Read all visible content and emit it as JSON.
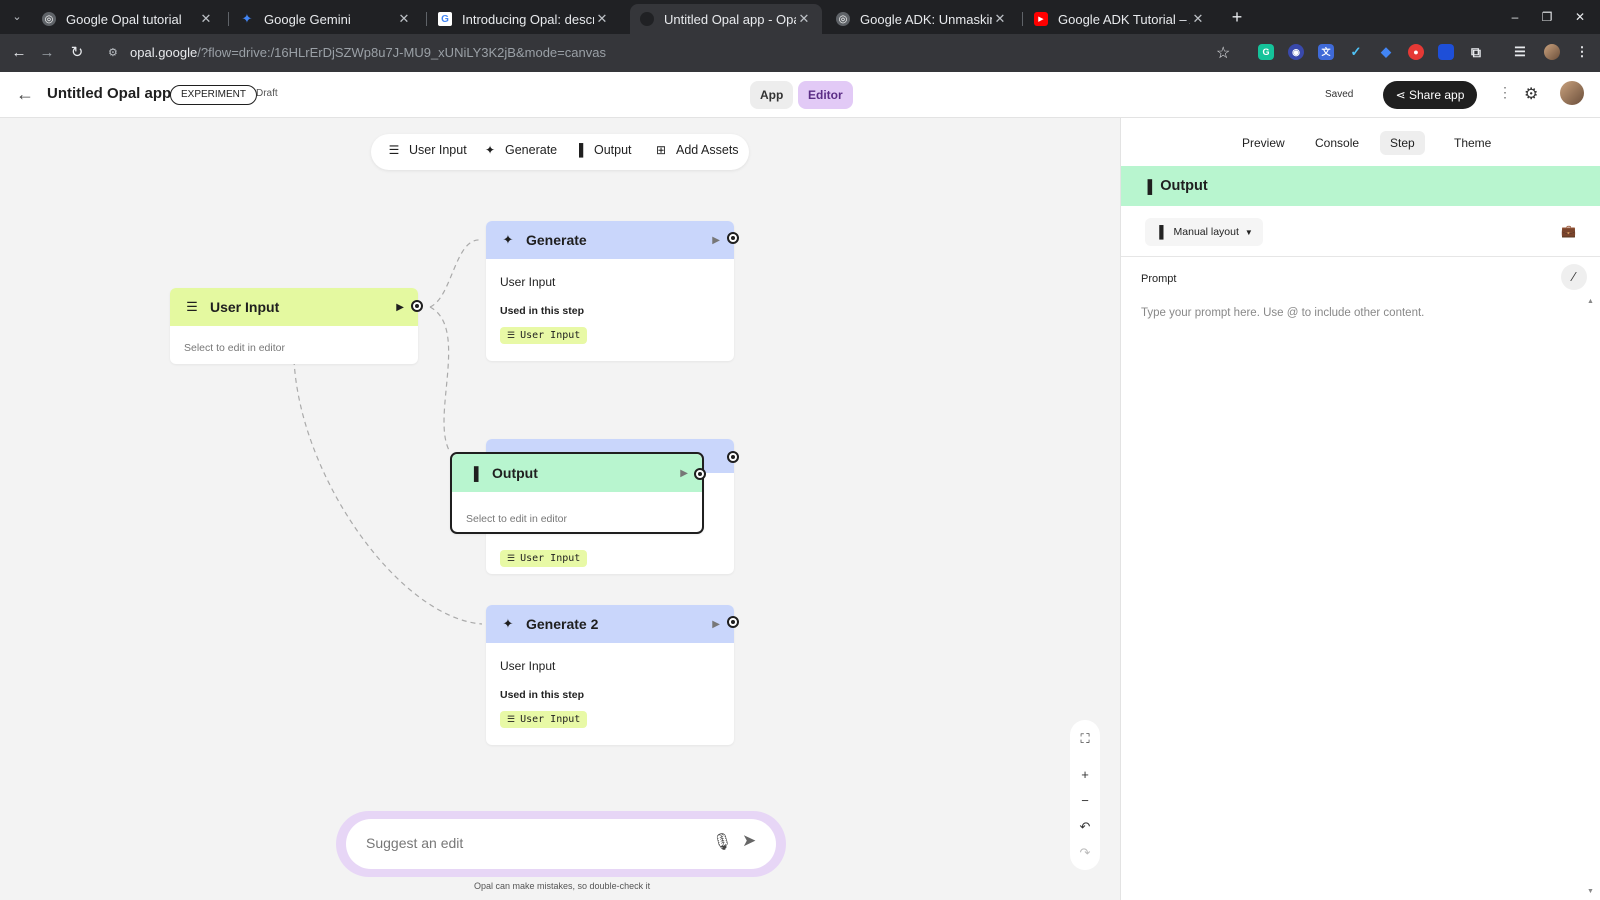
{
  "browser": {
    "tabs": [
      {
        "label": "Google Opal tutorial",
        "favicon_color": "#5f6368"
      },
      {
        "label": "Google Gemini",
        "favicon_color": "#4285f4"
      },
      {
        "label": "Introducing Opal: descri",
        "favicon_color": "#4285f4"
      },
      {
        "label": "Untitled Opal app - Opal",
        "favicon_color": "#202124"
      },
      {
        "label": "Google ADK: Unmasking",
        "favicon_color": "#5f6368"
      },
      {
        "label": "Google ADK Tutorial – Ag",
        "favicon_color": "#ff0000"
      }
    ],
    "active_tab": 3,
    "url_host": "opal.google",
    "url_path": "/?flow=drive:/16HLrErDjSZWp8u7J-MU9_xUNiLY3K2jB&mode=canvas"
  },
  "header": {
    "title": "Untitled Opal app",
    "badge": "EXPERIMENT",
    "status": "Draft",
    "mode_app": "App",
    "mode_editor": "Editor",
    "saved": "Saved",
    "share": "Share app"
  },
  "toolbar": {
    "user_input": "User Input",
    "generate": "Generate",
    "output": "Output",
    "add_assets": "Add Assets"
  },
  "nodes": {
    "user_input": {
      "title": "User Input",
      "placeholder": "Select to edit in editor"
    },
    "generate": {
      "title": "Generate",
      "input": "User Input",
      "used": "Used in this step",
      "chip": "User Input"
    },
    "output": {
      "title": "Output",
      "placeholder": "Select to edit in editor",
      "chip": "User Input"
    },
    "generate2": {
      "title": "Generate 2",
      "input": "User Input",
      "used": "Used in this step",
      "chip": "User Input"
    }
  },
  "suggest": {
    "placeholder": "Suggest an edit",
    "disclaimer": "Opal can make mistakes, so double-check it"
  },
  "panel": {
    "tabs": [
      "Preview",
      "Console",
      "Step",
      "Theme"
    ],
    "active_tab": "Step",
    "step_title": "Output",
    "layout": "Manual layout",
    "prompt_label": "Prompt",
    "prompt_placeholder": "Type your prompt here. Use @ to include other content."
  },
  "colors": {
    "user_input_node": "#e4f9a0",
    "generate_node": "#c9d6fb",
    "output_node": "#b8f5cf",
    "editor_accent": "#e2caf6"
  }
}
